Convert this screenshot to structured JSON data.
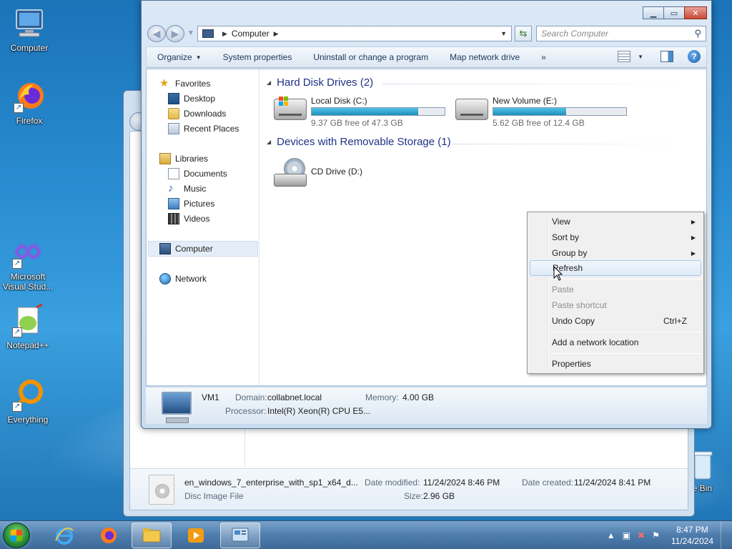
{
  "desktop": {
    "icons": [
      {
        "label": "Computer"
      },
      {
        "label": "Firefox"
      },
      {
        "label": "Microsoft Visual Stud..."
      },
      {
        "label": "Notepad++"
      },
      {
        "label": "Everything"
      },
      {
        "label": "cle Bin"
      }
    ]
  },
  "window": {
    "address": {
      "location": "Computer"
    },
    "search": {
      "placeholder": "Search Computer"
    },
    "toolbar": {
      "organize": "Organize",
      "system_properties": "System properties",
      "uninstall": "Uninstall or change a program",
      "map_drive": "Map network drive",
      "more": "»"
    },
    "nav": {
      "favorites": "Favorites",
      "desktop": "Desktop",
      "downloads": "Downloads",
      "recent_places": "Recent Places",
      "libraries": "Libraries",
      "documents": "Documents",
      "music": "Music",
      "pictures": "Pictures",
      "videos": "Videos",
      "computer": "Computer",
      "network": "Network"
    },
    "groups": {
      "hdd_header": "Hard Disk Drives (2)",
      "removable_header": "Devices with Removable Storage (1)"
    },
    "drives": [
      {
        "name": "Local Disk (C:)",
        "free_text": "9.37 GB free of 47.3 GB",
        "used_fraction": 0.8,
        "fill_percent": "80%"
      },
      {
        "name": "New Volume (E:)",
        "free_text": "5.62 GB free of 12.4 GB",
        "used_fraction": 0.55,
        "fill_percent": "55%"
      }
    ],
    "cd_drive": {
      "name": "CD Drive (D:)"
    },
    "details": {
      "computer_name": "VM1",
      "domain_label": "Domain:",
      "domain_value": "collabnet.local",
      "memory_label": "Memory:",
      "memory_value": "4.00 GB",
      "processor_label": "Processor:",
      "processor_value": "Intel(R) Xeon(R) CPU E5..."
    }
  },
  "context_menu": {
    "view": "View",
    "sort_by": "Sort by",
    "group_by": "Group by",
    "refresh": "Refresh",
    "paste": "Paste",
    "paste_shortcut": "Paste shortcut",
    "undo_copy": "Undo Copy",
    "undo_copy_accel": "Ctrl+Z",
    "add_network_location": "Add a network location",
    "properties": "Properties"
  },
  "back_window": {
    "file_name": "en_windows_7_enterprise_with_sp1_x64_d...",
    "file_type": "Disc Image File",
    "date_modified_label": "Date modified:",
    "date_modified": "11/24/2024 8:46 PM",
    "date_created_label": "Date created:",
    "date_created": "11/24/2024 8:41 PM",
    "size_label": "Size:",
    "size": "2.96 GB"
  },
  "taskbar": {
    "time": "8:47 PM",
    "date": "11/24/2024"
  }
}
